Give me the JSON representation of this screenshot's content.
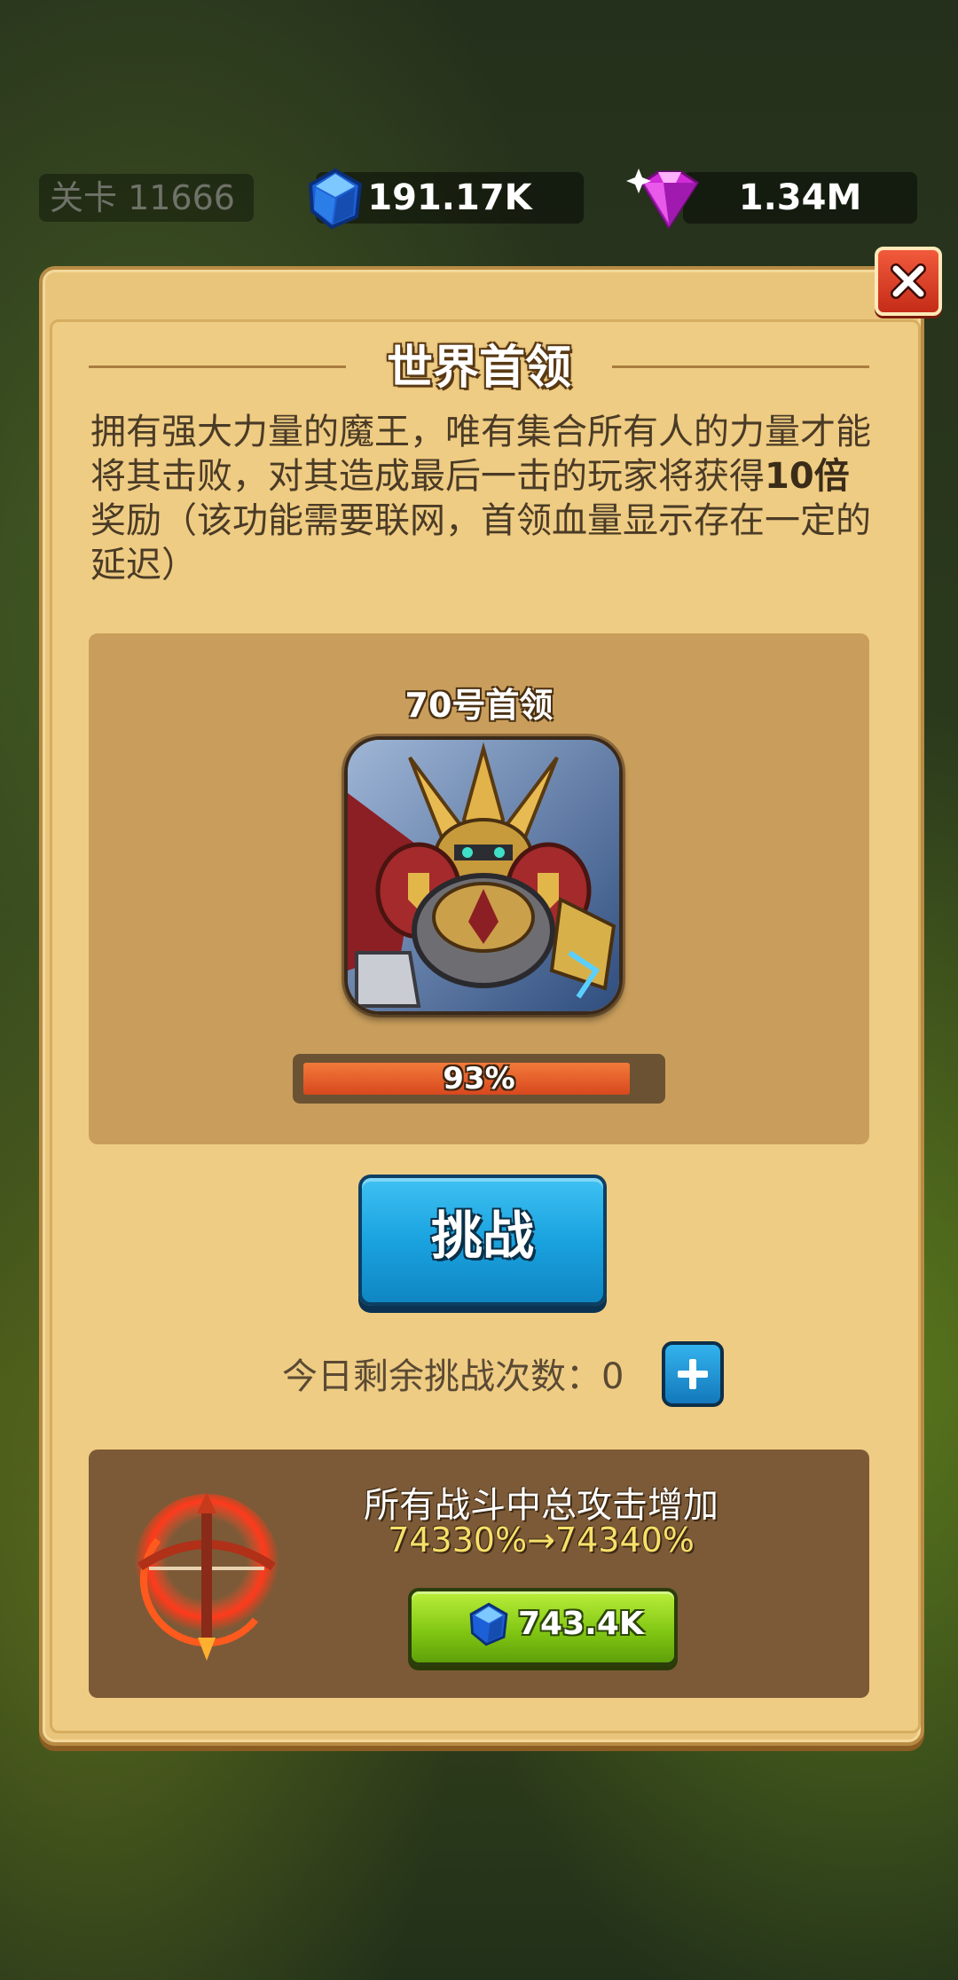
{
  "top_bar": {
    "level_label": "关卡 11666",
    "blue_gem_amount": "191.17K",
    "pink_gem_amount": "1.34M"
  },
  "panel": {
    "title": "世界首领",
    "description_pre": "拥有强大力量的魔王，唯有集合所有人的力量才能将其击败，对其造成最后一击的玩家将获得",
    "description_bold": "10倍",
    "description_post": "奖励（该功能需要联网，首领血量显示存在一定的延迟）"
  },
  "boss": {
    "name": "70号首领",
    "hp_percent": 93,
    "hp_label": "93%"
  },
  "challenge": {
    "button_label": "挑战",
    "remaining_label": "今日剩余挑战次数：0"
  },
  "upgrade": {
    "title": "所有战斗中总攻击增加",
    "values": "74330%→74340%",
    "cost": "743.4K"
  },
  "colors": {
    "panel_bg": "#efcc83",
    "challenge_blue": "#1aa3e0",
    "buy_green": "#7fc412",
    "hp_orange": "#e05a26",
    "upgrade_yellow": "#f7e06a"
  }
}
